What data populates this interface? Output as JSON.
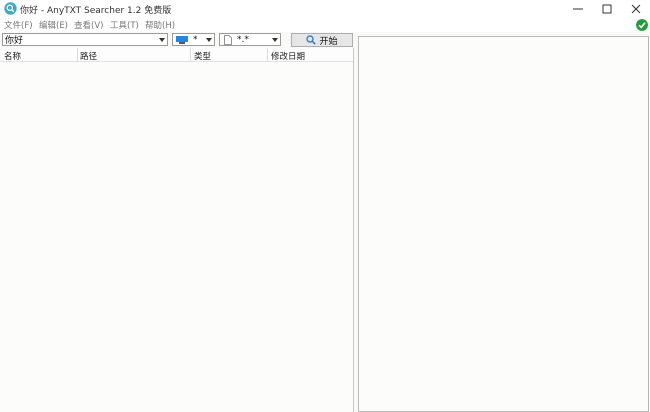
{
  "window": {
    "title": "你好 - AnyTXT Searcher 1.2 免费版",
    "minimize_glyph": "—",
    "maximize_glyph": "☐",
    "close_glyph": "✕"
  },
  "menu": {
    "items": [
      "文件(F)",
      "编辑(E)",
      "查看(V)",
      "工具(T)",
      "帮助(H)"
    ]
  },
  "toolbar": {
    "search_value": "你好",
    "drive_filter": "*",
    "file_filter": "*.*",
    "start_label": "开始"
  },
  "results": {
    "columns": [
      "名称",
      "路径",
      "类型",
      "修改日期"
    ],
    "rows": []
  },
  "colors": {
    "status_ok": "#1f9d3a",
    "drive_icon": "#1e88e5"
  }
}
